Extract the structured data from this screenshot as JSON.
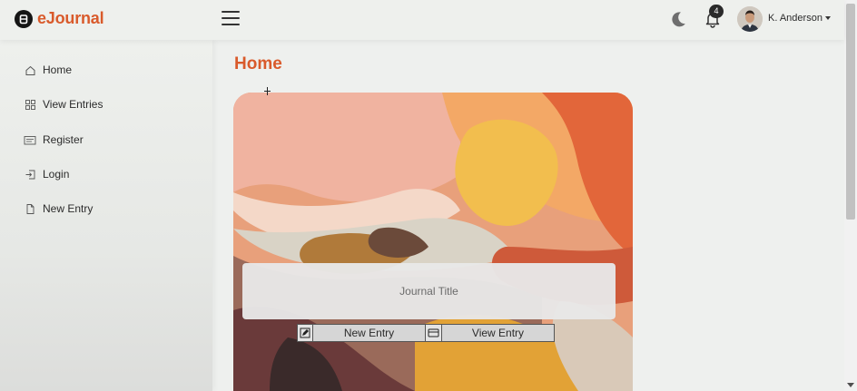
{
  "app": {
    "name": "eJournal"
  },
  "header": {
    "notification_count": "4",
    "user_name": "K. Anderson"
  },
  "sidebar": {
    "items": [
      {
        "label": "Home",
        "icon": "home-icon"
      },
      {
        "label": "View Entries",
        "icon": "grid-icon"
      },
      {
        "label": "Register",
        "icon": "card-icon"
      },
      {
        "label": "Login",
        "icon": "login-icon"
      },
      {
        "label": "New Entry",
        "icon": "document-icon"
      }
    ]
  },
  "main": {
    "page_title": "Home",
    "card": {
      "journal_title": "Journal Title",
      "new_entry_label": "New Entry",
      "view_entry_label": "View Entry"
    }
  },
  "colors": {
    "accent": "#d95a2b",
    "background": "#eef0ee"
  }
}
